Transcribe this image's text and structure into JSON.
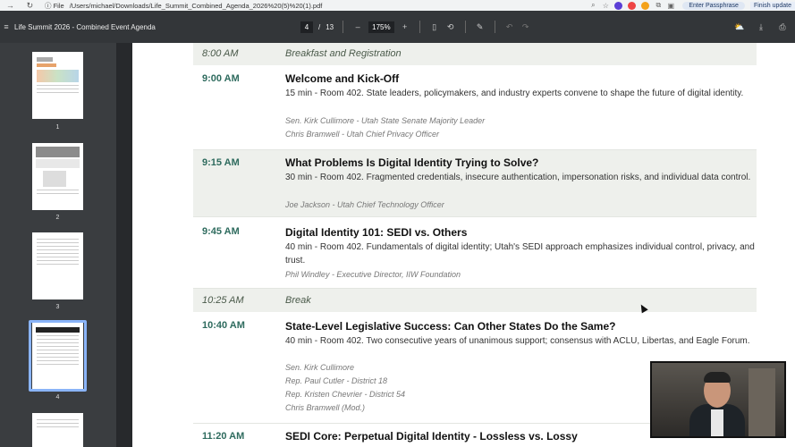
{
  "browser": {
    "file_chip": "File",
    "url": "/Users/michael/Downloads/Life_Summit_Combined_Agenda_2026%20(5)%20(1).pdf",
    "passphrase_label": "Enter Passphrase",
    "finish_label": "Finish update"
  },
  "toolbar": {
    "doc_title": "Life Summit 2026 - Combined Event Agenda",
    "page_current": "4",
    "page_sep": "/",
    "page_total": "13",
    "zoom_minus": "–",
    "zoom": "175%",
    "zoom_plus": "+"
  },
  "thumbnails": [
    {
      "label": "1"
    },
    {
      "label": "2"
    },
    {
      "label": "3"
    },
    {
      "label": "4"
    }
  ],
  "agenda": [
    {
      "time": "8:00 AM",
      "title": "Breakfast and Registration"
    },
    {
      "time": "9:00 AM",
      "title": "Welcome and Kick-Off",
      "desc": "15 min - Room 402. State leaders, policymakers, and industry experts convene to shape the future of digital identity.",
      "speakers": [
        "Sen. Kirk Cullimore - Utah State Senate Majority Leader",
        "Chris Bramwell - Utah Chief Privacy Officer"
      ]
    },
    {
      "time": "9:15 AM",
      "title": "What Problems Is Digital Identity Trying to Solve?",
      "desc": "30 min - Room 402. Fragmented credentials, insecure authentication, impersonation risks, and individual data control.",
      "speakers": [
        "Joe Jackson - Utah Chief Technology Officer"
      ]
    },
    {
      "time": "9:45 AM",
      "title": "Digital Identity 101: SEDI vs. Others",
      "desc": "40 min - Room 402. Fundamentals of digital identity; Utah's SEDI approach emphasizes individual control, privacy, and trust.",
      "speakers": [
        "Phil Windley - Executive Director, IIW Foundation"
      ]
    },
    {
      "time": "10:25 AM",
      "title": "Break"
    },
    {
      "time": "10:40 AM",
      "title": "State-Level Legislative Success: Can Other States Do the Same?",
      "desc": "40 min - Room 402. Two consecutive years of unanimous support; consensus with ACLU, Libertas, and Eagle Forum.",
      "speakers": [
        "Sen. Kirk Cullimore",
        "Rep. Paul Cutler - District 18",
        "Rep. Kristen Chevrier - District 54",
        "Chris Bramwell (Mod.)"
      ]
    },
    {
      "time": "11:20 AM",
      "title": "SEDI Core: Perpetual Digital Identity - Lossless vs. Lossy"
    }
  ]
}
